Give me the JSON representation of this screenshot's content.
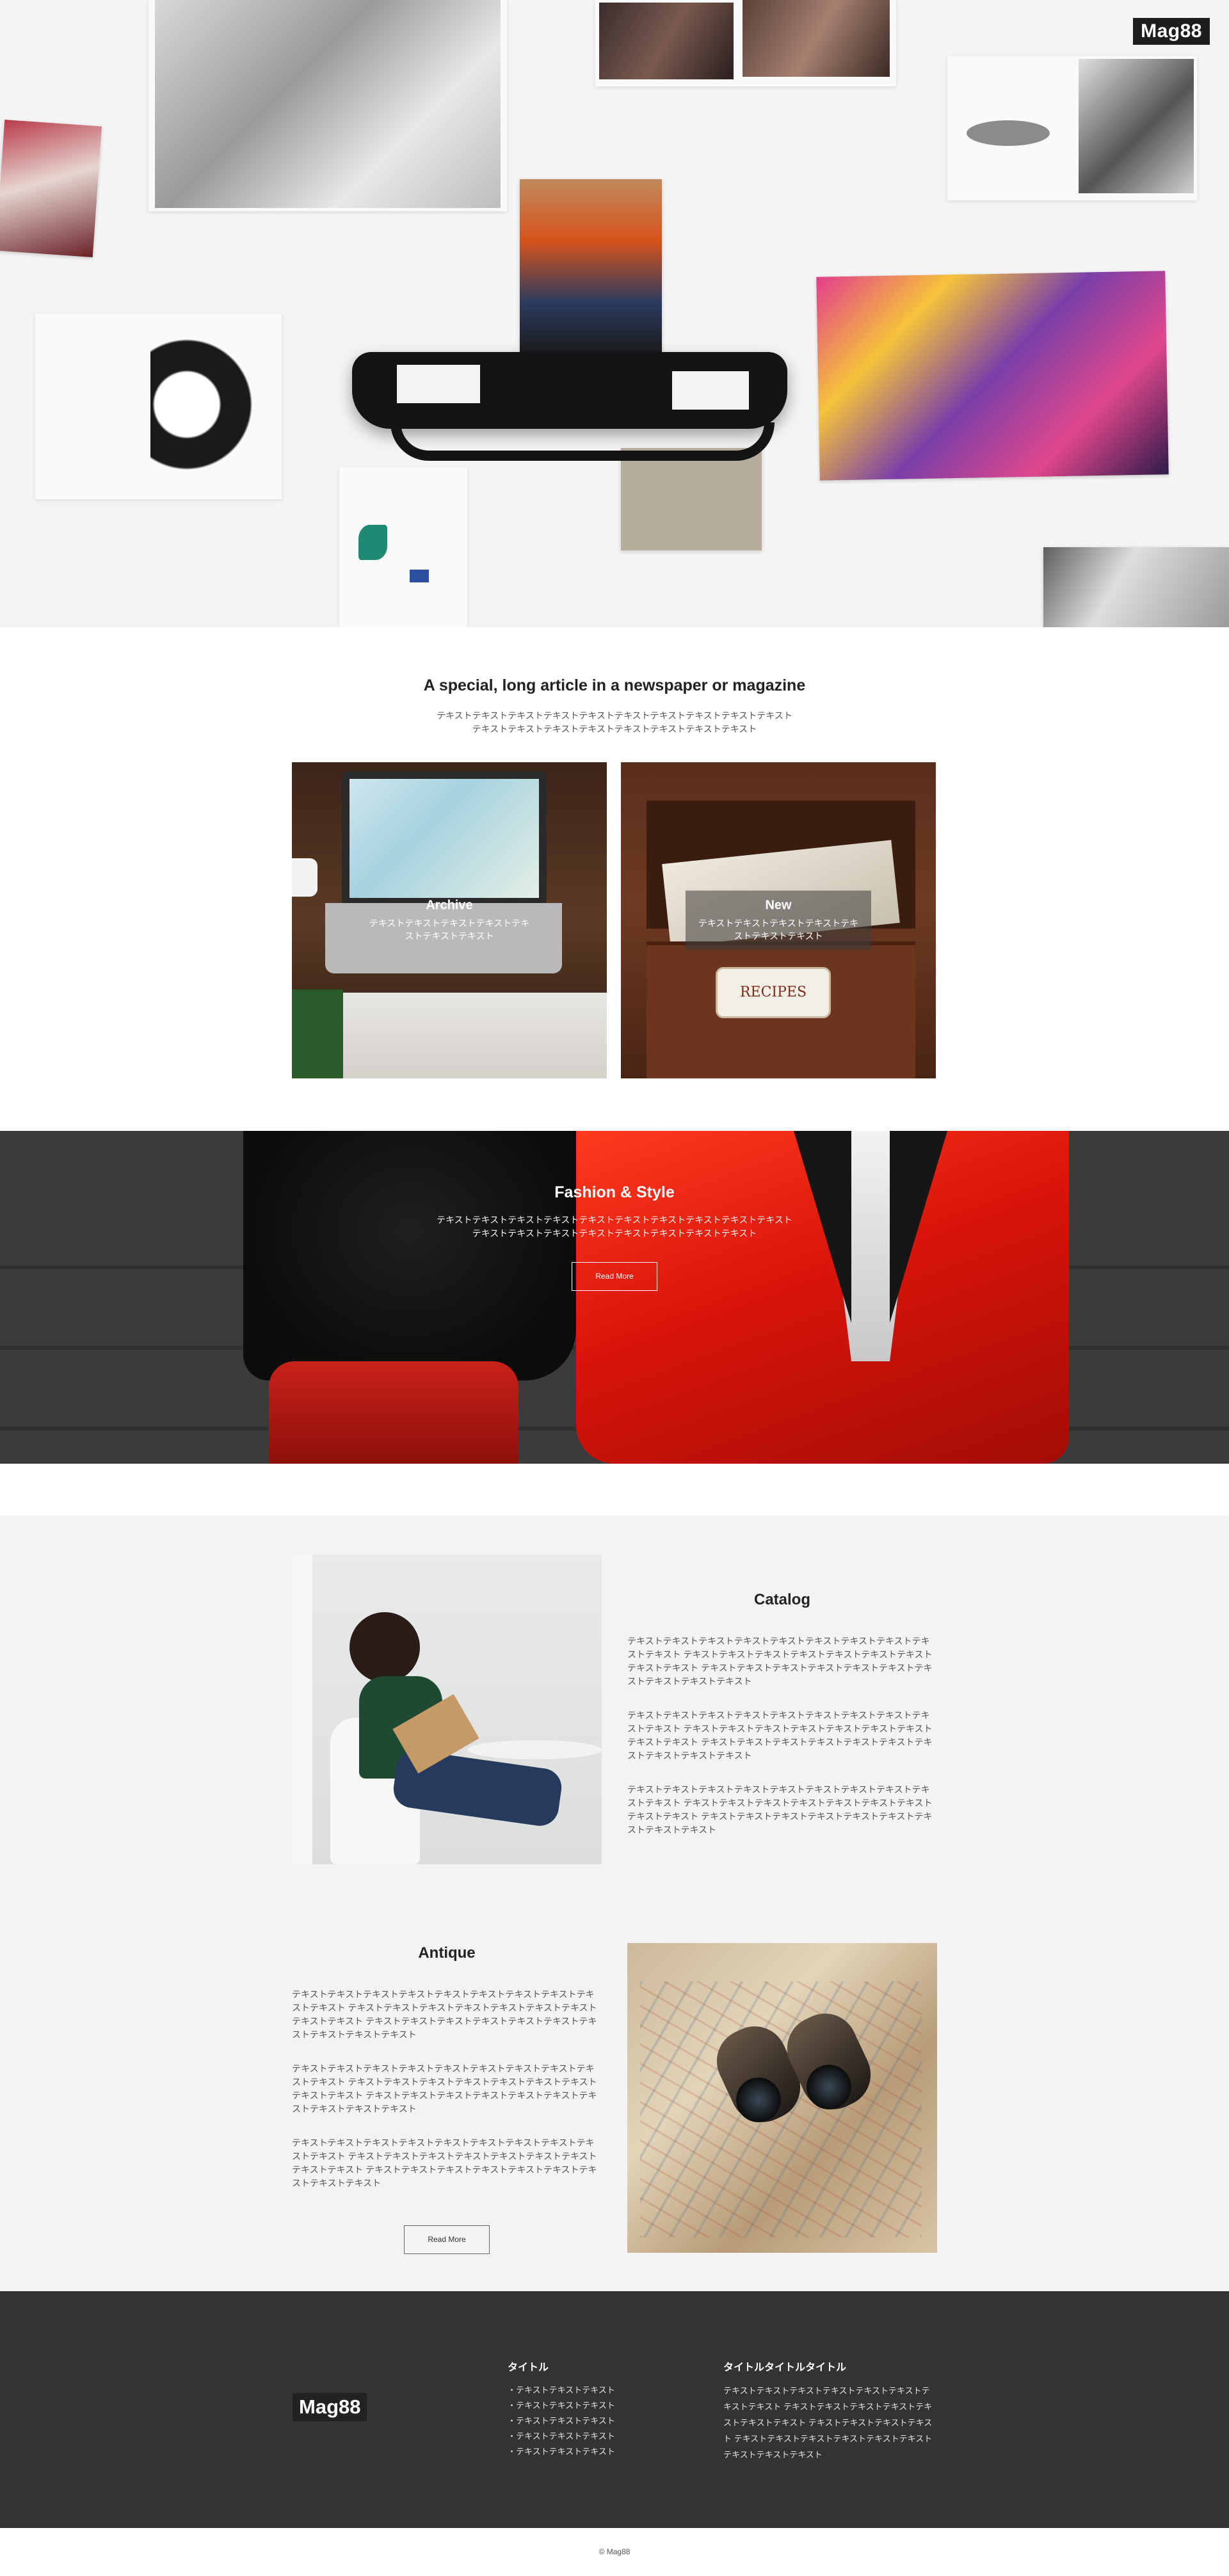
{
  "brand": {
    "logo": "Mag88"
  },
  "intro": {
    "title": "A special, long article in a newspaper or magazine",
    "text": "テキストテキストテキストテキストテキストテキストテキストテキストテキストテキスト テキストテキストテキストテキストテキストテキストテキストテキスト"
  },
  "cards": [
    {
      "title": "Archive",
      "text": "テキストテキストテキストテキストテキストテキストテキスト"
    },
    {
      "title": "New",
      "text": "テキストテキストテキストテキストテキストテキストテキスト"
    }
  ],
  "banner": {
    "title": "Fashion & Style",
    "text": "テキストテキストテキストテキストテキストテキストテキストテキストテキストテキスト テキストテキストテキストテキストテキストテキストテキストテキスト",
    "button": "Read More"
  },
  "catalog": {
    "title": "Catalog",
    "paragraphs": [
      "テキストテキストテキストテキストテキストテキストテキストテキストテキストテキスト テキストテキストテキストテキストテキストテキストテキストテキストテキスト テキストテキストテキストテキストテキストテキストテキストテキストテキストテキスト",
      "テキストテキストテキストテキストテキストテキストテキストテキストテキストテキスト テキストテキストテキストテキストテキストテキストテキストテキストテキスト テキストテキストテキストテキストテキストテキストテキストテキストテキストテキスト",
      "テキストテキストテキストテキストテキストテキストテキストテキストテキストテキスト テキストテキストテキストテキストテキストテキストテキストテキストテキスト テキストテキストテキストテキストテキストテキストテキストテキストテキスト"
    ]
  },
  "antique": {
    "title": "Antique",
    "paragraphs": [
      "テキストテキストテキストテキストテキストテキストテキストテキストテキストテキスト テキストテキストテキストテキストテキストテキストテキストテキストテキスト テキストテキストテキストテキストテキストテキストテキストテキストテキストテキスト",
      "テキストテキストテキストテキストテキストテキストテキストテキストテキストテキスト テキストテキストテキストテキストテキストテキストテキストテキストテキスト テキストテキストテキストテキストテキストテキストテキストテキストテキストテキスト",
      "テキストテキストテキストテキストテキストテキストテキストテキストテキストテキスト テキストテキストテキストテキストテキストテキストテキストテキストテキスト テキストテキストテキストテキストテキストテキストテキストテキストテキスト"
    ],
    "button": "Read More"
  },
  "footer": {
    "logo": "Mag88",
    "col1": {
      "title": "タイトル",
      "items": [
        "・テキストテキストテキスト",
        "・テキストテキストテキスト",
        "・テキストテキストテキスト",
        "・テキストテキストテキスト",
        "・テキストテキストテキスト"
      ]
    },
    "col2": {
      "title": "タイトルタイトルタイトル",
      "text": "テキストテキストテキストテキストテキストテキストテキストテキスト テキストテキストテキストテキストテキストテキストテキスト テキストテキストテキストテキスト テキストテキストテキストテキストテキストテキストテキストテキストテキスト"
    },
    "copyright": "© Mag88"
  }
}
